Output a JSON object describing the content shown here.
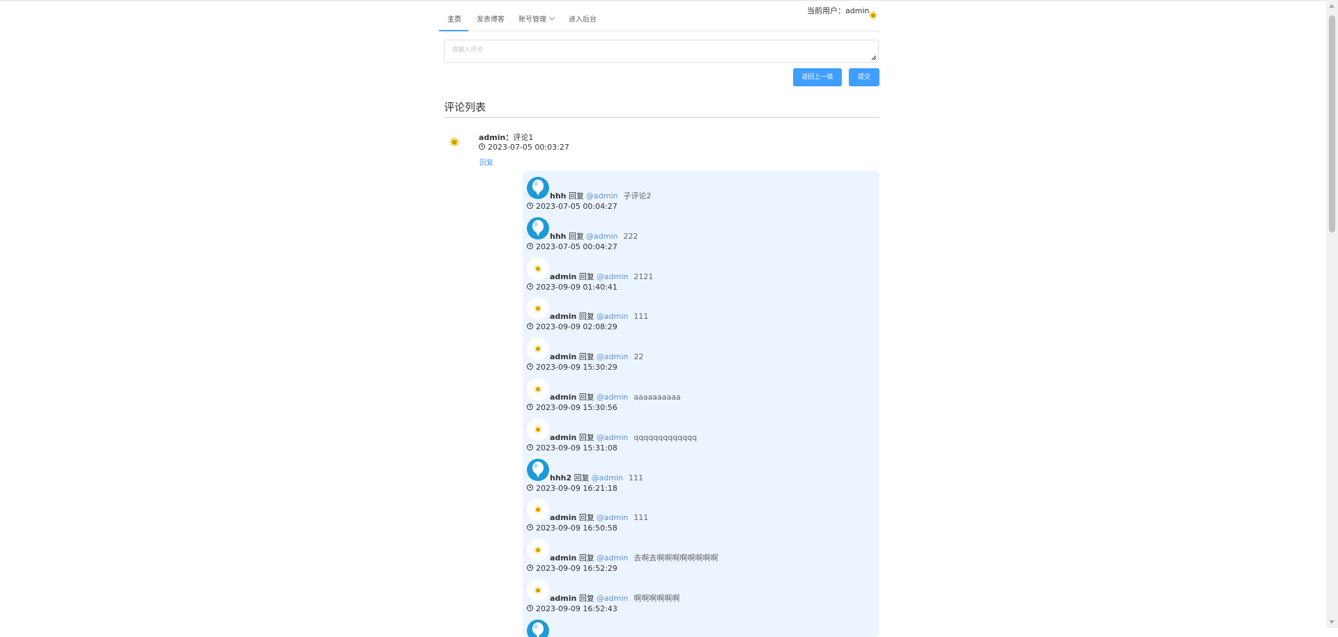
{
  "nav": {
    "items": [
      {
        "label": "主页",
        "active": true
      },
      {
        "label": "发表博客",
        "active": false
      },
      {
        "label": "账号管理",
        "active": false,
        "has_dropdown": true
      },
      {
        "label": "进入后台",
        "active": false
      }
    ],
    "current_user_label": "当前用户：",
    "current_user_name": "admin"
  },
  "comment_input": {
    "placeholder": "请输入评论",
    "value": ""
  },
  "buttons": {
    "back": "返回上一级",
    "submit": "提交"
  },
  "section_title": "评论列表",
  "main_comment": {
    "user": "admin",
    "separator": "：",
    "content": "评论1",
    "time": "2023-07-05 00:03:27",
    "reply_label": "回复"
  },
  "reply_verb": "回复",
  "replies": [
    {
      "user": "hhh",
      "avatar": "blue-balloon-icon",
      "target": "@admin",
      "content": "子评论2",
      "time": "2023-07-05 00:04:27"
    },
    {
      "user": "hhh",
      "avatar": "blue-balloon-icon",
      "target": "@admin",
      "content": "222",
      "time": "2023-07-05 00:04:27"
    },
    {
      "user": "admin",
      "avatar": "sun-face-icon",
      "target": "@admin",
      "content": "2121",
      "time": "2023-09-09 01:40:41"
    },
    {
      "user": "admin",
      "avatar": "sun-face-icon",
      "target": "@admin",
      "content": "111",
      "time": "2023-09-09 02:08:29"
    },
    {
      "user": "admin",
      "avatar": "sun-face-icon",
      "target": "@admin",
      "content": "22",
      "time": "2023-09-09 15:30:29"
    },
    {
      "user": "admin",
      "avatar": "sun-face-icon",
      "target": "@admin",
      "content": "aaaaaaaaaa",
      "time": "2023-09-09 15:30:56"
    },
    {
      "user": "admin",
      "avatar": "sun-face-icon",
      "target": "@admin",
      "content": "qqqqqqqqqqqqq",
      "time": "2023-09-09 15:31:08"
    },
    {
      "user": "hhh2",
      "avatar": "blue-balloon-icon",
      "target": "@admin",
      "content": "111",
      "time": "2023-09-09 16:21:18"
    },
    {
      "user": "admin",
      "avatar": "sun-face-icon",
      "target": "@admin",
      "content": "111",
      "time": "2023-09-09 16:50:58"
    },
    {
      "user": "admin",
      "avatar": "sun-face-icon",
      "target": "@admin",
      "content": "去啊去啊啊啊啊啊啊啊啊",
      "time": "2023-09-09 16:52:29"
    },
    {
      "user": "admin",
      "avatar": "sun-face-icon",
      "target": "@admin",
      "content": "啊啊啊啊啊啊",
      "time": "2023-09-09 16:52:43"
    },
    {
      "user": "",
      "avatar": "blue-balloon-icon",
      "target": "",
      "content": "",
      "time": ""
    }
  ],
  "colors": {
    "primary": "#409eff",
    "reply_panel_bg": "#ecf5ff",
    "mention": "#5d8fd8",
    "balloon": "#1e9bd7"
  }
}
